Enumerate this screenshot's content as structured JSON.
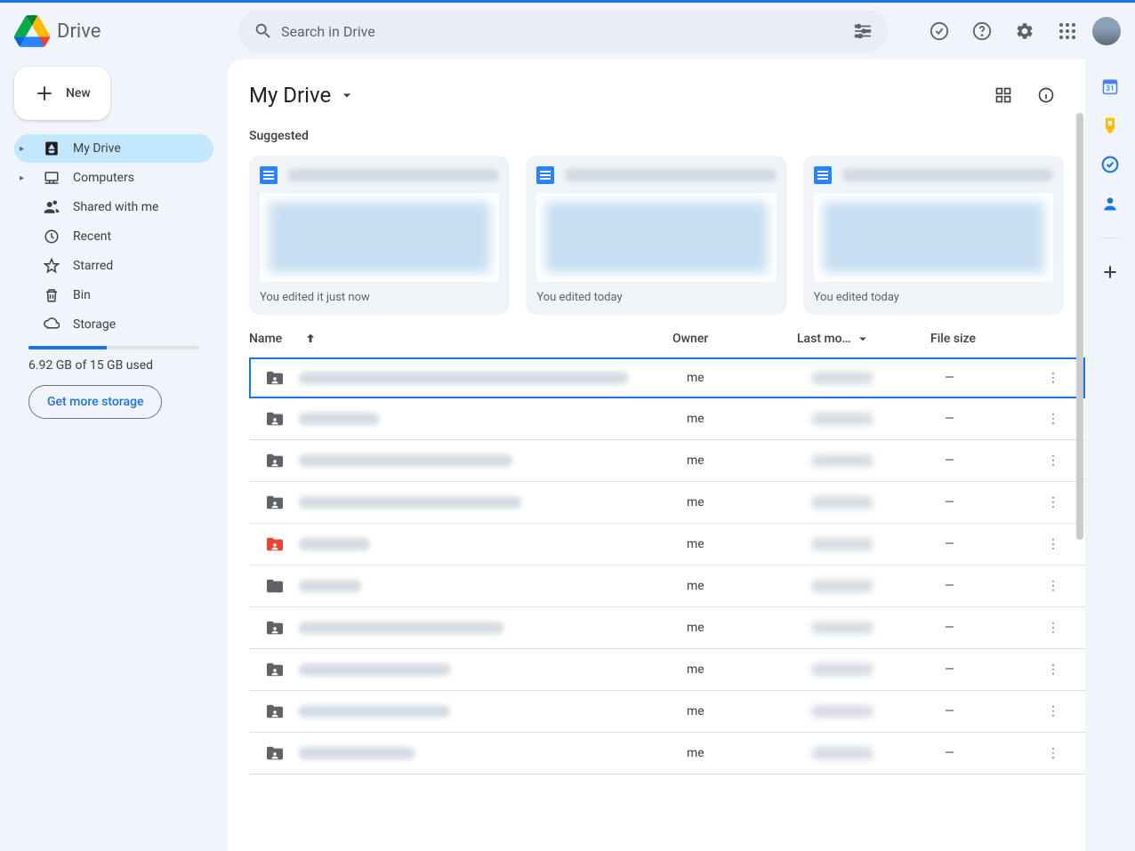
{
  "app": {
    "name": "Drive"
  },
  "search": {
    "placeholder": "Search in Drive"
  },
  "sidebar": {
    "new_label": "New",
    "items": [
      {
        "label": "My Drive"
      },
      {
        "label": "Computers"
      },
      {
        "label": "Shared with me"
      },
      {
        "label": "Recent"
      },
      {
        "label": "Starred"
      },
      {
        "label": "Bin"
      },
      {
        "label": "Storage"
      }
    ],
    "storage_text": "6.92 GB of 15 GB used",
    "storage_btn": "Get more storage"
  },
  "content": {
    "breadcrumb": "My Drive",
    "suggested_label": "Suggested",
    "suggested": [
      {
        "footer": "You edited it just now"
      },
      {
        "footer": "You edited today"
      },
      {
        "footer": "You edited today"
      }
    ],
    "columns": {
      "name": "Name",
      "owner": "Owner",
      "modified": "Last mo…",
      "size": "File size"
    },
    "rows": [
      {
        "owner": "me",
        "size": "—",
        "icon": "shared",
        "nameWidth": 370,
        "selected": true
      },
      {
        "owner": "me",
        "size": "—",
        "icon": "shared",
        "nameWidth": 90
      },
      {
        "owner": "me",
        "size": "—",
        "icon": "shared",
        "nameWidth": 240
      },
      {
        "owner": "me",
        "size": "—",
        "icon": "shared",
        "nameWidth": 250
      },
      {
        "owner": "me",
        "size": "—",
        "icon": "shared-red",
        "nameWidth": 80
      },
      {
        "owner": "me",
        "size": "—",
        "icon": "folder",
        "nameWidth": 70
      },
      {
        "owner": "me",
        "size": "—",
        "icon": "shared",
        "nameWidth": 230
      },
      {
        "owner": "me",
        "size": "—",
        "icon": "shared",
        "nameWidth": 170
      },
      {
        "owner": "me",
        "size": "—",
        "icon": "shared",
        "nameWidth": 170
      },
      {
        "owner": "me",
        "size": "—",
        "icon": "shared",
        "nameWidth": 130
      }
    ]
  }
}
